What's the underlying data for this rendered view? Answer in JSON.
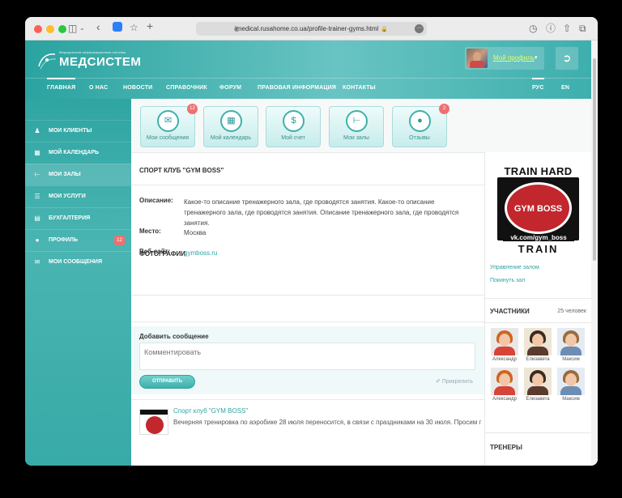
{
  "browser": {
    "url": "imedical.rusahome.co.ua/profile-trainer-gyms.html"
  },
  "header": {
    "logo_tagline": "Медицинская информационная система",
    "logo_name": "МЕДСИСТЕМ",
    "profile_label": "Мой профиль"
  },
  "nav": {
    "items": [
      "ГЛАВНАЯ",
      "О НАС",
      "НОВОСТИ",
      "СПРАВОЧНИК",
      "ФОРУМ",
      "ПРАВОВАЯ ИНФОРМАЦИЯ",
      "КОНТАКТЫ"
    ],
    "languages": [
      "РУС",
      "EN"
    ]
  },
  "sidebar": {
    "items": [
      {
        "label": "МОИ КЛИЕНТЫ",
        "icon": "clients-icon"
      },
      {
        "label": "МОЙ КАЛЕНДАРЬ",
        "icon": "calendar-icon"
      },
      {
        "label": "МОИ ЗАЛЫ",
        "icon": "dumbbell-icon"
      },
      {
        "label": "МОИ УСЛУГИ",
        "icon": "list-icon"
      },
      {
        "label": "БУХГАЛТЕРИЯ",
        "icon": "accounting-icon"
      },
      {
        "label": "ПРОФИЛЬ",
        "icon": "user-icon",
        "badge": "12"
      },
      {
        "label": "МОИ СООБЩЕНИЯ",
        "icon": "envelope-icon"
      }
    ]
  },
  "tiles": [
    {
      "label": "Мои сообщения",
      "badge": "12"
    },
    {
      "label": "Мой календарь"
    },
    {
      "label": "Мой счет"
    },
    {
      "label": "Мои залы"
    },
    {
      "label": "Отзывы",
      "badge": "2"
    }
  ],
  "club": {
    "title": "СПОРТ КЛУБ \"GYM BOSS\"",
    "description_label": "Описание:",
    "description": "Какое-то описание тренажерного зала, где проводятся занятия. Какое-то описание тренажерного зала, где проводятся занятия. Описание тренажерного зала, где проводятся занятия.",
    "place_label": "Место:",
    "place": "Москва",
    "website_label": "Веб-сайт:",
    "website": "gymboss.ru"
  },
  "photos": {
    "title": "ФОТОГРАФИИ"
  },
  "comment": {
    "title": "Добавить сообщение",
    "placeholder": "Комментировать",
    "send_label": "ОТПРАВИТЬ",
    "attach_label": "Прикрепить"
  },
  "post": {
    "author": "Спорт клуб \"GYM BOSS\"",
    "text": "Вечерняя тренировка по аэробике 28 июля переносится, в связи с праздниками на 30 июля. Просим прощения"
  },
  "right": {
    "logo_top": "TRAIN HARD",
    "logo_center": "GYM BOSS",
    "logo_vk": "vk.com/gym_boss",
    "logo_bottom": "TRAIN",
    "manage_link": "Управление залом",
    "leave_link": "Покинуть зал",
    "members_title": "УЧАСТНИКИ",
    "members_count": "25 человек",
    "members": [
      {
        "name": "Александр"
      },
      {
        "name": "Елизавета"
      },
      {
        "name": "Максим"
      },
      {
        "name": "Александр"
      },
      {
        "name": "Елизавета"
      },
      {
        "name": "Максим"
      }
    ],
    "trainers_title": "ТРЕНЕРЫ"
  }
}
